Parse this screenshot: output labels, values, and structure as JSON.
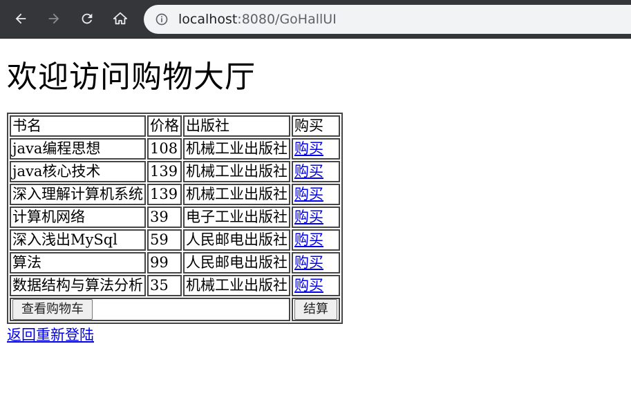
{
  "browser": {
    "url_host": "localhost",
    "url_rest": ":8080/GoHallUI"
  },
  "page": {
    "title": "欢迎访问购物大厅",
    "relogin_link": "返回重新登陆"
  },
  "table": {
    "headers": [
      "书名",
      "价格",
      "出版社",
      "购买"
    ],
    "rows": [
      {
        "name": "java编程思想",
        "price": "108",
        "publisher": "机械工业出版社",
        "buy": "购买"
      },
      {
        "name": "java核心技术",
        "price": "139",
        "publisher": "机械工业出版社",
        "buy": "购买"
      },
      {
        "name": "深入理解计算机系统",
        "price": "139",
        "publisher": "机械工业出版社",
        "buy": "购买"
      },
      {
        "name": "计算机网络",
        "price": "39",
        "publisher": "电子工业出版社",
        "buy": "购买"
      },
      {
        "name": "深入浅出MySql",
        "price": "59",
        "publisher": "人民邮电出版社",
        "buy": "购买"
      },
      {
        "name": "算法",
        "price": "99",
        "publisher": "人民邮电出版社",
        "buy": "购买"
      },
      {
        "name": "数据结构与算法分析",
        "price": "35",
        "publisher": "机械工业出版社",
        "buy": "购买"
      }
    ],
    "view_cart_label": "查看购物车",
    "checkout_label": "结算"
  },
  "colors": {
    "chrome_bg": "#35363a",
    "omnibox_bg": "#f1f3f4",
    "link": "#0000ee"
  }
}
